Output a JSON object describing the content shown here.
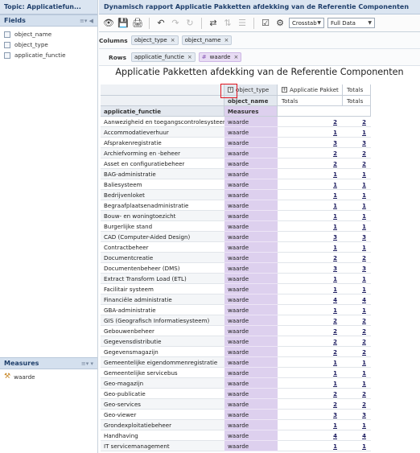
{
  "sidebar": {
    "topic": "Topic: Applicatiefun...",
    "fields_title": "Fields",
    "fields": [
      "object_name",
      "object_type",
      "applicatie_functie"
    ],
    "measures_title": "Measures",
    "measures": [
      "waarde"
    ]
  },
  "report": {
    "window_title": "Dynamisch rapport Applicatie Pakketten afdekking van de Referentie Componenten",
    "view_mode": "Crosstab",
    "data_mode": "Full Data",
    "columns_label": "Columns",
    "rows_label": "Rows",
    "columns": [
      "object_type",
      "object_name"
    ],
    "rows": [
      "applicatie_functie",
      "waarde"
    ],
    "title": "Applicatie Pakketten afdekking van de Referentie Componenten"
  },
  "crosstab": {
    "col_field_1": "object_type",
    "col_field_2": "object_name",
    "col_group": "Applicatie Pakket",
    "totals_label": "Totals",
    "row_header": "applicatie_functie",
    "measures_header": "Measures",
    "rows": [
      {
        "name": "Aanwezigheid en toegangscontrolesysteem",
        "measure": "waarde",
        "value": "2",
        "total": "2"
      },
      {
        "name": "Accommodatieverhuur",
        "measure": "waarde",
        "value": "1",
        "total": "1"
      },
      {
        "name": "Afsprakenregistratie",
        "measure": "waarde",
        "value": "3",
        "total": "3"
      },
      {
        "name": "Archiefvorming en -beheer",
        "measure": "waarde",
        "value": "2",
        "total": "2"
      },
      {
        "name": "Asset en configuratiebeheer",
        "measure": "waarde",
        "value": "2",
        "total": "2"
      },
      {
        "name": "BAG-administratie",
        "measure": "waarde",
        "value": "1",
        "total": "1"
      },
      {
        "name": "Baliesysteem",
        "measure": "waarde",
        "value": "1",
        "total": "1"
      },
      {
        "name": "Bedrijvenloket",
        "measure": "waarde",
        "value": "1",
        "total": "1"
      },
      {
        "name": "Begraafplaatsenadministratie",
        "measure": "waarde",
        "value": "1",
        "total": "1"
      },
      {
        "name": "Bouw- en woningtoezicht",
        "measure": "waarde",
        "value": "1",
        "total": "1"
      },
      {
        "name": "Burgerlijke stand",
        "measure": "waarde",
        "value": "1",
        "total": "1"
      },
      {
        "name": "CAD (Computer-Aided Design)",
        "measure": "waarde",
        "value": "3",
        "total": "3"
      },
      {
        "name": "Contractbeheer",
        "measure": "waarde",
        "value": "1",
        "total": "1"
      },
      {
        "name": "Documentcreatie",
        "measure": "waarde",
        "value": "2",
        "total": "2"
      },
      {
        "name": "Documentenbeheer (DMS)",
        "measure": "waarde",
        "value": "3",
        "total": "3"
      },
      {
        "name": "Extract Transform Load (ETL)",
        "measure": "waarde",
        "value": "1",
        "total": "1"
      },
      {
        "name": "Facilitair systeem",
        "measure": "waarde",
        "value": "1",
        "total": "1"
      },
      {
        "name": "Financiële administratie",
        "measure": "waarde",
        "value": "4",
        "total": "4"
      },
      {
        "name": "GBA-administratie",
        "measure": "waarde",
        "value": "1",
        "total": "1"
      },
      {
        "name": "GIS (Geografisch Informatiesysteem)",
        "measure": "waarde",
        "value": "2",
        "total": "2"
      },
      {
        "name": "Gebouwenbeheer",
        "measure": "waarde",
        "value": "2",
        "total": "2"
      },
      {
        "name": "Gegevensdistributie",
        "measure": "waarde",
        "value": "2",
        "total": "2"
      },
      {
        "name": "Gegevensmagazijn",
        "measure": "waarde",
        "value": "2",
        "total": "2"
      },
      {
        "name": "Gemeentelijke eigendommenregistratie",
        "measure": "waarde",
        "value": "1",
        "total": "1"
      },
      {
        "name": "Gemeentelijke servicebus",
        "measure": "waarde",
        "value": "1",
        "total": "1"
      },
      {
        "name": "Geo-magazijn",
        "measure": "waarde",
        "value": "1",
        "total": "1"
      },
      {
        "name": "Geo-publicatie",
        "measure": "waarde",
        "value": "2",
        "total": "2"
      },
      {
        "name": "Geo-services",
        "measure": "waarde",
        "value": "2",
        "total": "2"
      },
      {
        "name": "Geo-viewer",
        "measure": "waarde",
        "value": "3",
        "total": "3"
      },
      {
        "name": "Grondexploitatiebeheer",
        "measure": "waarde",
        "value": "1",
        "total": "1"
      },
      {
        "name": "Handhaving",
        "measure": "waarde",
        "value": "4",
        "total": "4"
      },
      {
        "name": "IT servicemanagement",
        "measure": "waarde",
        "value": "1",
        "total": "1"
      }
    ]
  }
}
